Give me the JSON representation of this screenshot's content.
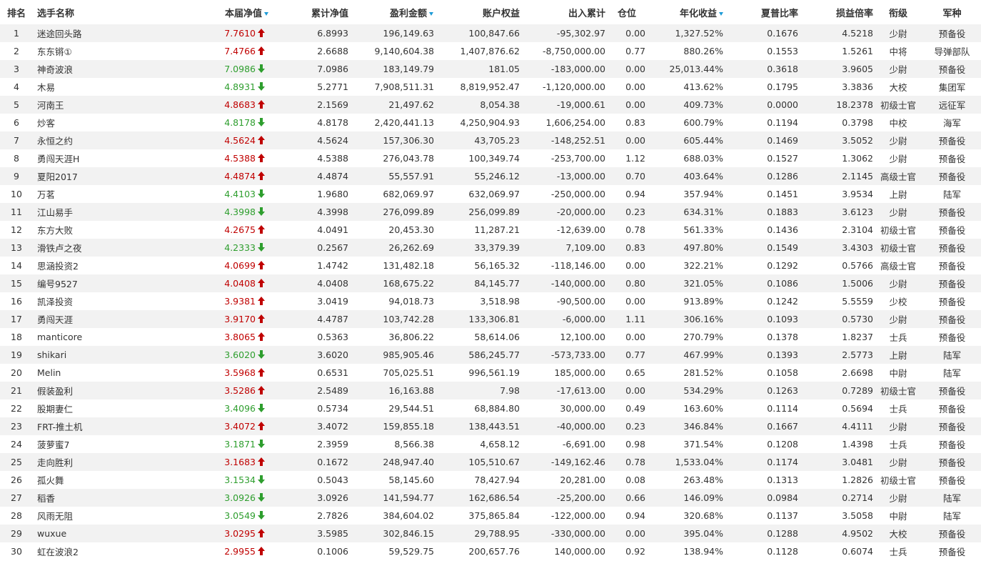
{
  "colors": {
    "up": "#c00000",
    "down": "#2e9e2e",
    "sort_indicator": "#1e9bd7",
    "row_alt": "#f2f2f2"
  },
  "headers": [
    "排名",
    "选手名称",
    "本届净值",
    "累计净值",
    "盈利金额",
    "账户权益",
    "出入累计",
    "仓位",
    "年化收益",
    "夏普比率",
    "损益倍率",
    "衔级",
    "军种"
  ],
  "sorted_columns": [
    "本届净值",
    "盈利金额",
    "年化收益"
  ],
  "rows": [
    {
      "rank": "1",
      "name": "迷途回头路",
      "nav": "7.7610",
      "trend": "up",
      "cum": "6.8993",
      "profit": "196,149.63",
      "equity": "100,847.66",
      "flow": "-95,302.97",
      "pos": "0.00",
      "ann": "1,327.52%",
      "sharpe": "0.1676",
      "pl": "4.5218",
      "grade": "少尉",
      "branch": "预备役"
    },
    {
      "rank": "2",
      "name": "东东锵①",
      "nav": "7.4766",
      "trend": "up",
      "cum": "2.6688",
      "profit": "9,140,604.38",
      "equity": "1,407,876.62",
      "flow": "-8,750,000.00",
      "pos": "0.77",
      "ann": "880.26%",
      "sharpe": "0.1553",
      "pl": "1.5261",
      "grade": "中将",
      "branch": "导弹部队"
    },
    {
      "rank": "3",
      "name": "神奇波浪",
      "nav": "7.0986",
      "trend": "down",
      "cum": "7.0986",
      "profit": "183,149.79",
      "equity": "181.05",
      "flow": "-183,000.00",
      "pos": "0.00",
      "ann": "25,013.44%",
      "sharpe": "0.3618",
      "pl": "3.9605",
      "grade": "少尉",
      "branch": "预备役"
    },
    {
      "rank": "4",
      "name": "木易",
      "nav": "4.8931",
      "trend": "down",
      "cum": "5.2771",
      "profit": "7,908,511.31",
      "equity": "8,819,952.47",
      "flow": "-1,120,000.00",
      "pos": "0.00",
      "ann": "413.62%",
      "sharpe": "0.1795",
      "pl": "3.3836",
      "grade": "大校",
      "branch": "集团军"
    },
    {
      "rank": "5",
      "name": "河南王",
      "nav": "4.8683",
      "trend": "up",
      "cum": "2.1569",
      "profit": "21,497.62",
      "equity": "8,054.38",
      "flow": "-19,000.61",
      "pos": "0.00",
      "ann": "409.73%",
      "sharpe": "0.0000",
      "pl": "18.2378",
      "grade": "初级士官",
      "branch": "远征军"
    },
    {
      "rank": "6",
      "name": "炒客",
      "nav": "4.8178",
      "trend": "down",
      "cum": "4.8178",
      "profit": "2,420,441.13",
      "equity": "4,250,904.93",
      "flow": "1,606,254.00",
      "pos": "0.83",
      "ann": "600.79%",
      "sharpe": "0.1194",
      "pl": "0.3798",
      "grade": "中校",
      "branch": "海军"
    },
    {
      "rank": "7",
      "name": "永恒之约",
      "nav": "4.5624",
      "trend": "up",
      "cum": "4.5624",
      "profit": "157,306.30",
      "equity": "43,705.23",
      "flow": "-148,252.51",
      "pos": "0.00",
      "ann": "605.44%",
      "sharpe": "0.1469",
      "pl": "3.5052",
      "grade": "少尉",
      "branch": "预备役"
    },
    {
      "rank": "8",
      "name": "勇闯天涯H",
      "nav": "4.5388",
      "trend": "up",
      "cum": "4.5388",
      "profit": "276,043.78",
      "equity": "100,349.74",
      "flow": "-253,700.00",
      "pos": "1.12",
      "ann": "688.03%",
      "sharpe": "0.1527",
      "pl": "1.3062",
      "grade": "少尉",
      "branch": "预备役"
    },
    {
      "rank": "9",
      "name": "夏阳2017",
      "nav": "4.4874",
      "trend": "up",
      "cum": "4.4874",
      "profit": "55,557.91",
      "equity": "55,246.12",
      "flow": "-13,000.00",
      "pos": "0.70",
      "ann": "403.64%",
      "sharpe": "0.1286",
      "pl": "2.1145",
      "grade": "高级士官",
      "branch": "预备役"
    },
    {
      "rank": "10",
      "name": "万茗",
      "nav": "4.4103",
      "trend": "down",
      "cum": "1.9680",
      "profit": "682,069.97",
      "equity": "632,069.97",
      "flow": "-250,000.00",
      "pos": "0.94",
      "ann": "357.94%",
      "sharpe": "0.1451",
      "pl": "3.9534",
      "grade": "上尉",
      "branch": "陆军"
    },
    {
      "rank": "11",
      "name": "江山易手",
      "nav": "4.3998",
      "trend": "down",
      "cum": "4.3998",
      "profit": "276,099.89",
      "equity": "256,099.89",
      "flow": "-20,000.00",
      "pos": "0.23",
      "ann": "634.31%",
      "sharpe": "0.1883",
      "pl": "3.6123",
      "grade": "少尉",
      "branch": "预备役"
    },
    {
      "rank": "12",
      "name": "东方大败",
      "nav": "4.2675",
      "trend": "up",
      "cum": "4.0491",
      "profit": "20,453.30",
      "equity": "11,287.21",
      "flow": "-12,639.00",
      "pos": "0.78",
      "ann": "561.33%",
      "sharpe": "0.1436",
      "pl": "2.3104",
      "grade": "初级士官",
      "branch": "预备役"
    },
    {
      "rank": "13",
      "name": "滑铁卢之夜",
      "nav": "4.2333",
      "trend": "down",
      "cum": "0.2567",
      "profit": "26,262.69",
      "equity": "33,379.39",
      "flow": "7,109.00",
      "pos": "0.83",
      "ann": "497.80%",
      "sharpe": "0.1549",
      "pl": "3.4303",
      "grade": "初级士官",
      "branch": "预备役"
    },
    {
      "rank": "14",
      "name": "思涵投资2",
      "nav": "4.0699",
      "trend": "up",
      "cum": "1.4742",
      "profit": "131,482.18",
      "equity": "56,165.32",
      "flow": "-118,146.00",
      "pos": "0.00",
      "ann": "322.21%",
      "sharpe": "0.1292",
      "pl": "0.5766",
      "grade": "高级士官",
      "branch": "预备役"
    },
    {
      "rank": "15",
      "name": "编号9527",
      "nav": "4.0408",
      "trend": "up",
      "cum": "4.0408",
      "profit": "168,675.22",
      "equity": "84,145.77",
      "flow": "-140,000.00",
      "pos": "0.80",
      "ann": "321.05%",
      "sharpe": "0.1086",
      "pl": "1.5006",
      "grade": "少尉",
      "branch": "预备役"
    },
    {
      "rank": "16",
      "name": "凯泽投资",
      "nav": "3.9381",
      "trend": "up",
      "cum": "3.0419",
      "profit": "94,018.73",
      "equity": "3,518.98",
      "flow": "-90,500.00",
      "pos": "0.00",
      "ann": "913.89%",
      "sharpe": "0.1242",
      "pl": "5.5559",
      "grade": "少校",
      "branch": "预备役"
    },
    {
      "rank": "17",
      "name": "勇闯天涯",
      "nav": "3.9170",
      "trend": "up",
      "cum": "4.4787",
      "profit": "103,742.28",
      "equity": "133,306.81",
      "flow": "-6,000.00",
      "pos": "1.11",
      "ann": "306.16%",
      "sharpe": "0.1093",
      "pl": "0.5730",
      "grade": "少尉",
      "branch": "预备役"
    },
    {
      "rank": "18",
      "name": "manticore",
      "nav": "3.8065",
      "trend": "up",
      "cum": "0.5363",
      "profit": "36,806.22",
      "equity": "58,614.06",
      "flow": "12,100.00",
      "pos": "0.00",
      "ann": "270.79%",
      "sharpe": "0.1378",
      "pl": "1.8237",
      "grade": "士兵",
      "branch": "预备役"
    },
    {
      "rank": "19",
      "name": "shikari",
      "nav": "3.6020",
      "trend": "down",
      "cum": "3.6020",
      "profit": "985,905.46",
      "equity": "586,245.77",
      "flow": "-573,733.00",
      "pos": "0.77",
      "ann": "467.99%",
      "sharpe": "0.1393",
      "pl": "2.5773",
      "grade": "上尉",
      "branch": "陆军"
    },
    {
      "rank": "20",
      "name": "Melin",
      "nav": "3.5968",
      "trend": "up",
      "cum": "0.6531",
      "profit": "705,025.51",
      "equity": "996,561.19",
      "flow": "185,000.00",
      "pos": "0.65",
      "ann": "281.52%",
      "sharpe": "0.1058",
      "pl": "2.6698",
      "grade": "中尉",
      "branch": "陆军"
    },
    {
      "rank": "21",
      "name": "假装盈利",
      "nav": "3.5286",
      "trend": "up",
      "cum": "2.5489",
      "profit": "16,163.88",
      "equity": "7.98",
      "flow": "-17,613.00",
      "pos": "0.00",
      "ann": "534.29%",
      "sharpe": "0.1263",
      "pl": "0.7289",
      "grade": "初级士官",
      "branch": "预备役"
    },
    {
      "rank": "22",
      "name": "股期妻仁",
      "nav": "3.4096",
      "trend": "down",
      "cum": "0.5734",
      "profit": "29,544.51",
      "equity": "68,884.80",
      "flow": "30,000.00",
      "pos": "0.49",
      "ann": "163.60%",
      "sharpe": "0.1114",
      "pl": "0.5694",
      "grade": "士兵",
      "branch": "预备役"
    },
    {
      "rank": "23",
      "name": "FRT-推土机",
      "nav": "3.4072",
      "trend": "up",
      "cum": "3.4072",
      "profit": "159,855.18",
      "equity": "138,443.51",
      "flow": "-40,000.00",
      "pos": "0.23",
      "ann": "346.84%",
      "sharpe": "0.1667",
      "pl": "4.4111",
      "grade": "少尉",
      "branch": "预备役"
    },
    {
      "rank": "24",
      "name": "菠萝蜜7",
      "nav": "3.1871",
      "trend": "down",
      "cum": "2.3959",
      "profit": "8,566.38",
      "equity": "4,658.12",
      "flow": "-6,691.00",
      "pos": "0.98",
      "ann": "371.54%",
      "sharpe": "0.1208",
      "pl": "1.4398",
      "grade": "士兵",
      "branch": "预备役"
    },
    {
      "rank": "25",
      "name": "走向胜利",
      "nav": "3.1683",
      "trend": "up",
      "cum": "0.1672",
      "profit": "248,947.40",
      "equity": "105,510.67",
      "flow": "-149,162.46",
      "pos": "0.78",
      "ann": "1,533.04%",
      "sharpe": "0.1174",
      "pl": "3.0481",
      "grade": "少尉",
      "branch": "预备役"
    },
    {
      "rank": "26",
      "name": "孤火舞",
      "nav": "3.1534",
      "trend": "down",
      "cum": "0.5043",
      "profit": "58,145.60",
      "equity": "78,427.94",
      "flow": "20,281.00",
      "pos": "0.08",
      "ann": "263.48%",
      "sharpe": "0.1313",
      "pl": "1.2826",
      "grade": "初级士官",
      "branch": "预备役"
    },
    {
      "rank": "27",
      "name": "稻香",
      "nav": "3.0926",
      "trend": "down",
      "cum": "3.0926",
      "profit": "141,594.77",
      "equity": "162,686.54",
      "flow": "-25,200.00",
      "pos": "0.66",
      "ann": "146.09%",
      "sharpe": "0.0984",
      "pl": "0.2714",
      "grade": "少尉",
      "branch": "陆军"
    },
    {
      "rank": "28",
      "name": "风雨无阻",
      "nav": "3.0549",
      "trend": "down",
      "cum": "2.7826",
      "profit": "384,604.02",
      "equity": "375,865.84",
      "flow": "-122,000.00",
      "pos": "0.94",
      "ann": "320.68%",
      "sharpe": "0.1137",
      "pl": "3.5058",
      "grade": "中尉",
      "branch": "陆军"
    },
    {
      "rank": "29",
      "name": "wuxue",
      "nav": "3.0295",
      "trend": "up",
      "cum": "3.5985",
      "profit": "302,846.15",
      "equity": "29,788.95",
      "flow": "-330,000.00",
      "pos": "0.00",
      "ann": "395.04%",
      "sharpe": "0.1288",
      "pl": "4.9502",
      "grade": "大校",
      "branch": "预备役"
    },
    {
      "rank": "30",
      "name": "虹在波浪2",
      "nav": "2.9955",
      "trend": "up",
      "cum": "0.1006",
      "profit": "59,529.75",
      "equity": "200,657.76",
      "flow": "140,000.00",
      "pos": "0.92",
      "ann": "138.94%",
      "sharpe": "0.1128",
      "pl": "0.6074",
      "grade": "士兵",
      "branch": "预备役"
    }
  ]
}
